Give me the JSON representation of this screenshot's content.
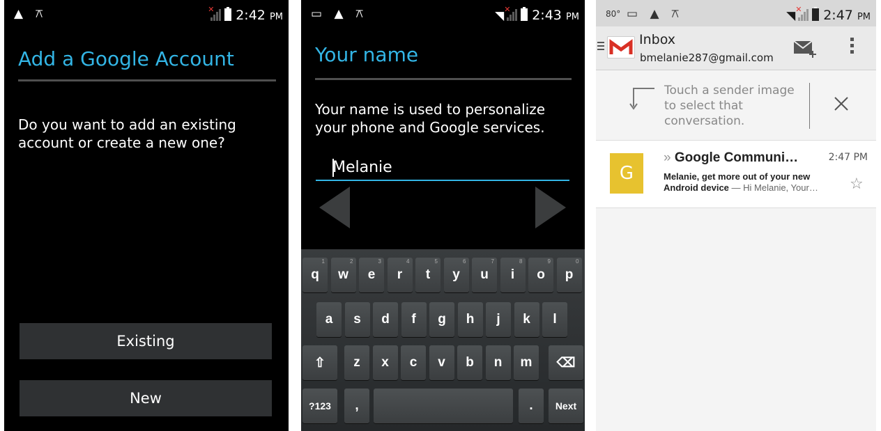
{
  "screen1": {
    "status_time": "2:42",
    "status_ampm": "PM",
    "title": "Add a Google Account",
    "question": "Do you want to add an existing account or create a new one?",
    "existing_label": "Existing",
    "new_label": "New"
  },
  "screen2": {
    "status_time": "2:43",
    "status_ampm": "PM",
    "title": "Your name",
    "description": "Your name is used to personalize your phone and Google services.",
    "name_value": "Melanie",
    "keyboard": {
      "row1": [
        [
          "q",
          "1"
        ],
        [
          "w",
          "2"
        ],
        [
          "e",
          "3"
        ],
        [
          "r",
          "4"
        ],
        [
          "t",
          "5"
        ],
        [
          "y",
          "6"
        ],
        [
          "u",
          "7"
        ],
        [
          "i",
          "8"
        ],
        [
          "o",
          "9"
        ],
        [
          "p",
          "0"
        ]
      ],
      "row2": [
        "a",
        "s",
        "d",
        "f",
        "g",
        "h",
        "j",
        "k",
        "l"
      ],
      "row3": [
        "z",
        "x",
        "c",
        "v",
        "b",
        "n",
        "m"
      ],
      "symbols_label": "?123",
      "comma": ",",
      "period": ".",
      "next_label": "Next"
    }
  },
  "screen3": {
    "status_temp": "80°",
    "status_time": "2:47",
    "status_ampm": "PM",
    "header_title": "Inbox",
    "account_email": "bmelanie287@gmail.com",
    "tip_text": "Touch a sender image to select that conversation.",
    "message": {
      "avatar_letter": "G",
      "avatar_color": "#e7c22f",
      "sender": "Google Communi…",
      "sender_prefix": "»",
      "time": "2:47 PM",
      "subject_line1": "Melanie, get more out of your new",
      "subject_line2": "Android device",
      "snippet": " — Hi Melanie, Your…"
    }
  },
  "colors": {
    "accent": "#33b5e5",
    "screen_bg": "#000000",
    "button_bg": "#2f3133",
    "gmail_red": "#d93025"
  }
}
